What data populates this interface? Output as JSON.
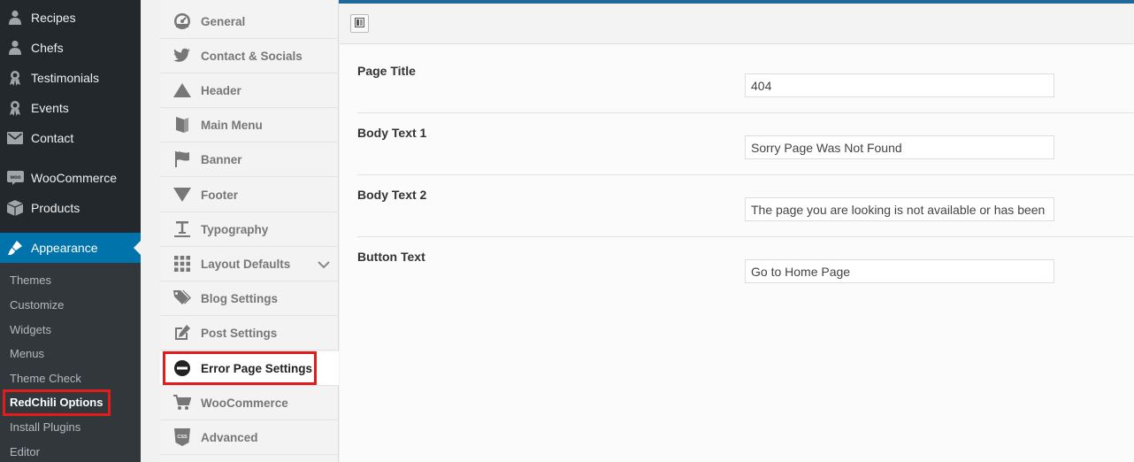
{
  "admin_menu": {
    "items": [
      {
        "label": "Recipes",
        "icon": "user-icon"
      },
      {
        "label": "Chefs",
        "icon": "user-icon"
      },
      {
        "label": "Testimonials",
        "icon": "award-icon"
      },
      {
        "label": "Events",
        "icon": "award-icon"
      },
      {
        "label": "Contact",
        "icon": "mail-icon"
      },
      {
        "label": "WooCommerce",
        "icon": "woo-icon"
      },
      {
        "label": "Products",
        "icon": "products-icon"
      },
      {
        "label": "Appearance",
        "icon": "brush-icon"
      }
    ],
    "submenu": [
      "Themes",
      "Customize",
      "Widgets",
      "Menus",
      "Theme Check",
      "RedChili Options",
      "Install Plugins",
      "Editor"
    ],
    "active_submenu": "RedChili Options",
    "accent_color": "#0073aa",
    "highlight_color": "#e21b1b"
  },
  "option_tabs": [
    {
      "label": "General",
      "icon": "dashboard-icon"
    },
    {
      "label": "Contact & Socials",
      "icon": "twitter-icon"
    },
    {
      "label": "Header",
      "icon": "triangle-up-icon"
    },
    {
      "label": "Main Menu",
      "icon": "book-icon"
    },
    {
      "label": "Banner",
      "icon": "flag-icon"
    },
    {
      "label": "Footer",
      "icon": "triangle-down-icon"
    },
    {
      "label": "Typography",
      "icon": "text-icon"
    },
    {
      "label": "Layout Defaults",
      "icon": "grid-icon"
    },
    {
      "label": "Blog Settings",
      "icon": "tags-icon"
    },
    {
      "label": "Post Settings",
      "icon": "edit-icon"
    },
    {
      "label": "Error Page Settings",
      "icon": "no-entry-icon"
    },
    {
      "label": "WooCommerce",
      "icon": "cart-icon"
    },
    {
      "label": "Advanced",
      "icon": "css-icon"
    }
  ],
  "active_tab": "Error Page Settings",
  "fields": [
    {
      "label": "Page Title",
      "value": "404"
    },
    {
      "label": "Body Text 1",
      "value": "Sorry Page Was Not Found"
    },
    {
      "label": "Body Text 2",
      "value": "The page you are looking is not available or has been removed"
    },
    {
      "label": "Button Text",
      "value": "Go to Home Page"
    }
  ]
}
